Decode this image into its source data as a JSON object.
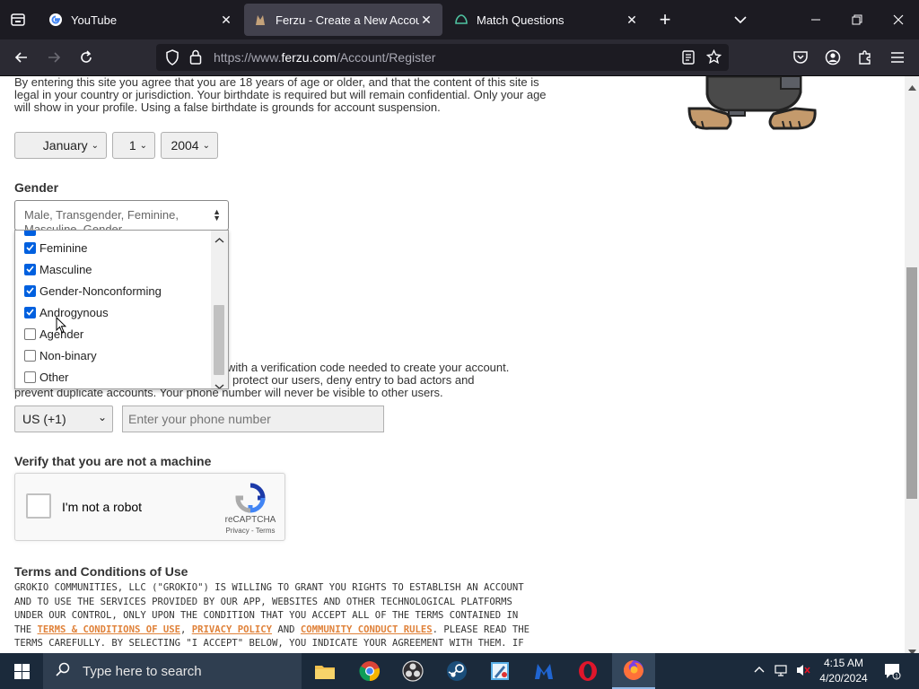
{
  "browser": {
    "tabs": [
      {
        "label": "YouTube",
        "icon": "google-icon",
        "active": false
      },
      {
        "label": "Ferzu - Create a New Account",
        "icon": "ferzu-icon",
        "active": true
      },
      {
        "label": "Match Questions",
        "icon": "match-icon",
        "active": false
      }
    ],
    "url": {
      "prefix": "https://www.",
      "host": "ferzu.com",
      "path": "/Account/Register"
    }
  },
  "page": {
    "age_text": "By entering this site you agree that you are 18 years of age or older, and that the content of this site is legal in your country or jurisdiction. Your birthdate is required but will remain confidential. Only your age will show in your profile. Using a false birthdate is grounds for account suspension.",
    "birthdate": {
      "month": "January",
      "day": "1",
      "year": "2004"
    },
    "gender_label": "Gender",
    "gender_select_value": "Male, Transgender, Feminine, Masculine, Gender-",
    "gender_options": [
      {
        "label": "Feminine",
        "checked": true
      },
      {
        "label": "Masculine",
        "checked": true
      },
      {
        "label": "Gender-Nonconforming",
        "checked": true
      },
      {
        "label": "Androgynous",
        "checked": true
      },
      {
        "label": "Agender",
        "checked": false
      },
      {
        "label": "Non-binary",
        "checked": false
      },
      {
        "label": "Other",
        "checked": false
      }
    ],
    "phone_text_line1": "with a verification code needed to create your account.",
    "phone_text_line2": "protect our users, deny entry to bad actors and",
    "phone_text_line3": "prevent duplicate accounts. Your phone number will never be visible to other users.",
    "phone_country": "US (+1)",
    "phone_placeholder": "Enter your phone number",
    "verify_label": "Verify that you are not a machine",
    "captcha": {
      "label": "I'm not a robot",
      "brand": "reCAPTCHA",
      "links": "Privacy - Terms"
    },
    "terms_heading": "Terms and Conditions of Use",
    "terms": {
      "p1": "GROKIO COMMUNITIES, LLC (\"GROKIO\") IS WILLING TO GRANT YOU RIGHTS TO ESTABLISH AN ACCOUNT AND TO USE THE SERVICES PROVIDED BY OUR APP, WEBSITES AND OTHER TECHNOLOGICAL PLATFORMS UNDER OUR CONTROL, ONLY UPON THE CONDITION THAT YOU ACCEPT ALL OF THE TERMS CONTAINED IN THE ",
      "link1": "TERMS & CONDITIONS OF USE",
      "sep1": ", ",
      "link2": "PRIVACY POLICY",
      "sep2": " AND ",
      "link3": "COMMUNITY CONDUCT RULES",
      "p2": ". PLEASE READ THE TERMS CAREFULLY. BY SELECTING \"I ACCEPT\" BELOW, YOU INDICATE YOUR AGREEMENT WITH THEM. IF YOU ARE ENTERING INTO THIS AGREEMENT ON BEHALF OF A COMPANY OR"
    }
  },
  "taskbar": {
    "search_placeholder": "Type here to search",
    "time": "4:15 AM",
    "date": "4/20/2024"
  },
  "colors": {
    "accent": "#0060df",
    "terms_link": "#e0823a",
    "tab_bg": "#1c1b22",
    "nav_bg": "#2b2a33"
  }
}
